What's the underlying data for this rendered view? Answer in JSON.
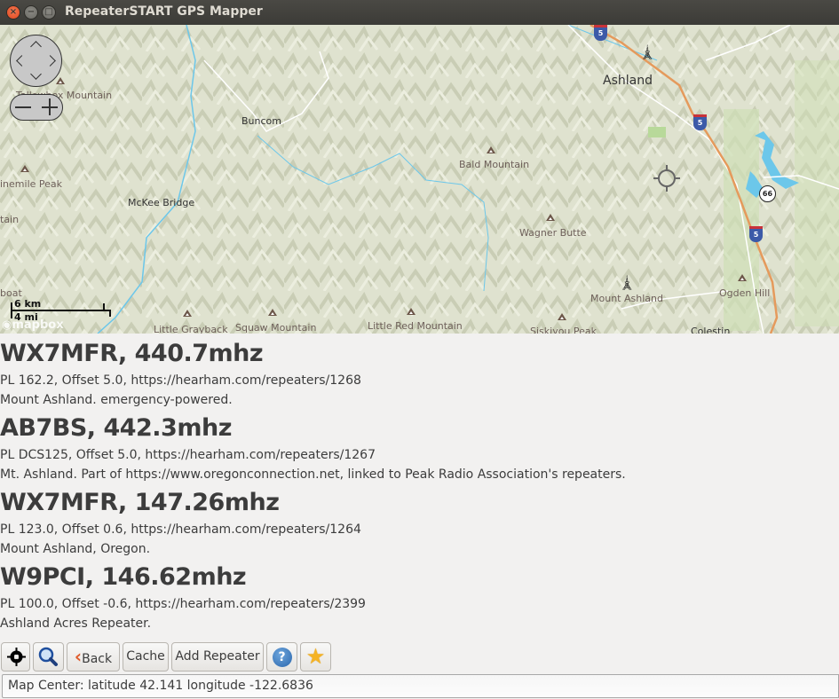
{
  "window": {
    "title": "RepeaterSTART GPS Mapper",
    "close_glyph": "×",
    "minimize_glyph": "−",
    "maximize_glyph": "□"
  },
  "map": {
    "attribution": "mapbox",
    "scale": {
      "metric": "6 km",
      "imperial": "4 mi"
    },
    "labels": {
      "ashland": "Ashland",
      "buncom": "Buncom",
      "bald_mountain": "Bald Mountain",
      "mckee_bridge": "McKee Bridge",
      "ninemile_peak": "inemile Peak",
      "tain": "tain",
      "tallowbox": "Tallowbox Mountain",
      "wagner_butte": "Wagner Butte",
      "mount_ashland": "Mount Ashland",
      "ogden_hill": "Ogden Hill",
      "boat": "boat",
      "little_grayback": "Little Grayback",
      "squaw_mountain": "Squaw Mountain",
      "little_red_mountain": "Little Red Mountain",
      "siskiyou_peak": "Siskiyou Peak",
      "colestin": "Colestin"
    },
    "shields": {
      "i5": "5",
      "or66": "66"
    },
    "colors": {
      "land": "#dde0cc",
      "water": "#6cc7ea",
      "highway": "#e59a5c",
      "road": "#ffffff",
      "park": "#b8d99a"
    }
  },
  "repeaters": [
    {
      "title": "WX7MFR, 440.7mhz",
      "details": "PL 162.2, Offset 5.0, https://hearham.com/repeaters/1268",
      "description": "Mount Ashland. emergency-powered."
    },
    {
      "title": "AB7BS, 442.3mhz",
      "details": "PL DCS125, Offset 5.0, https://hearham.com/repeaters/1267",
      "description": "Mt. Ashland. Part of https://www.oregonconnection.net, linked to Peak Radio Association's repeaters."
    },
    {
      "title": "WX7MFR, 147.26mhz",
      "details": "PL 123.0, Offset 0.6, https://hearham.com/repeaters/1264",
      "description": "Mount Ashland, Oregon."
    },
    {
      "title": "W9PCI, 146.62mhz",
      "details": "PL 100.0, Offset -0.6, https://hearham.com/repeaters/2399",
      "description": "Ashland Acres Repeater."
    }
  ],
  "toolbar": {
    "locate_icon": "gps-target-icon",
    "search_icon": "magnifier-icon",
    "back_label": "Back",
    "back_glyph": "‹",
    "cache_label": "Cache",
    "add_repeater_label": "Add Repeater",
    "help_glyph": "?",
    "favorite_glyph": "★"
  },
  "status": {
    "text": "Map Center: latitude 42.141 longitude -122.6836"
  }
}
